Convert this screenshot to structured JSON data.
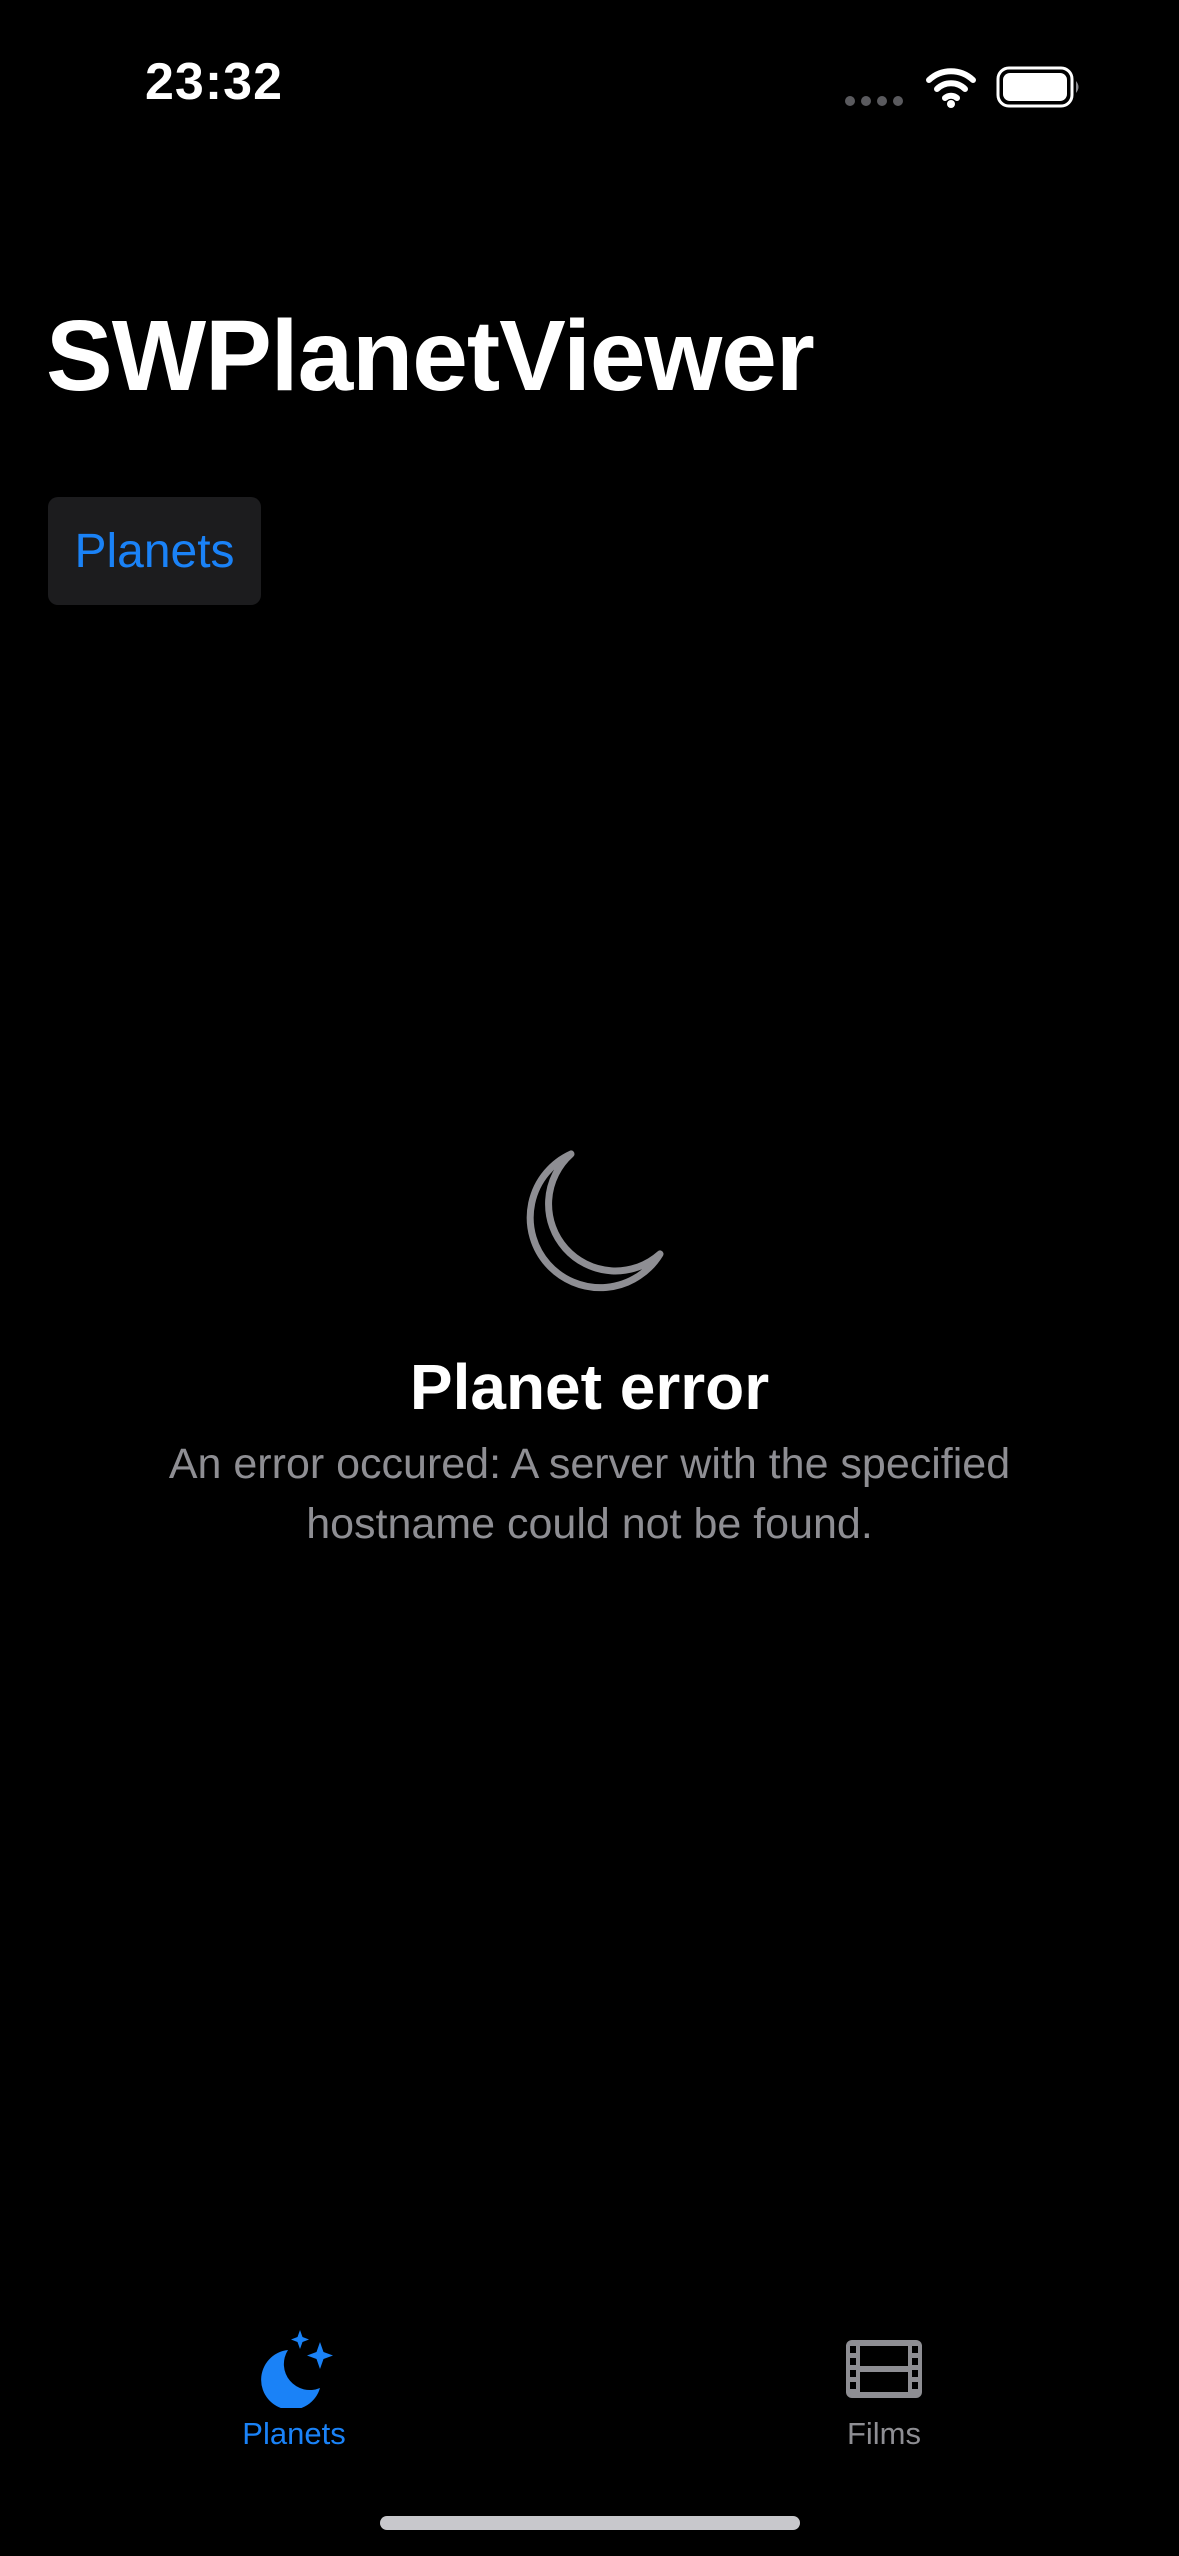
{
  "status_bar": {
    "time": "23:32",
    "icons": [
      "cellular-dots-icon",
      "wifi-icon",
      "battery-icon"
    ]
  },
  "navigation": {
    "large_title": "SWPlanetViewer",
    "segment_label": "Planets"
  },
  "error_state": {
    "icon": "moon-icon",
    "title": "Planet error",
    "message": "An error occured: A server with the specified hostname could not be found."
  },
  "tab_bar": {
    "tabs": [
      {
        "label": "Planets",
        "icon": "moon-stars-icon",
        "selected": true
      },
      {
        "label": "Films",
        "icon": "film-icon",
        "selected": false
      }
    ]
  },
  "colors": {
    "background": "#000000",
    "accent": "#1a82f7",
    "secondary_text": "#8e8e93",
    "control_background": "#1c1c1e"
  }
}
